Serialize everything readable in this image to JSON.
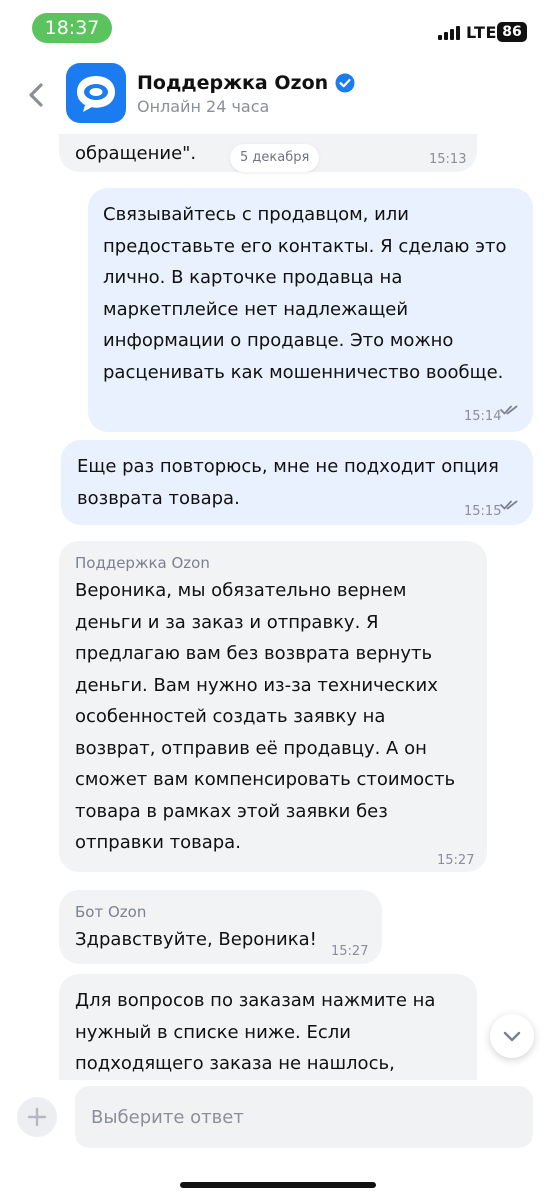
{
  "status_bar": {
    "time": "18:37",
    "network": "LTE",
    "battery": "86"
  },
  "header": {
    "title": "Поддержка Ozon",
    "subtitle": "Онлайн 24 часа",
    "icons": {
      "back": "chevron-left-icon",
      "verified": "verified-check-icon",
      "avatar": "chat-bubble-logo"
    },
    "colors": {
      "accent": "#1a7cf0",
      "verified": "#1a7cf0"
    }
  },
  "date_separator": "5 декабря",
  "messages": [
    {
      "direction": "in",
      "lines": [
        "обращение\"."
      ],
      "time": "15:13"
    },
    {
      "direction": "out",
      "lines": [
        "Связывайтесь с продавцом, или",
        "предоставьте его контакты. Я сделаю это",
        "лично. В карточке продавца на",
        "маркетплейсе нет надлежащей",
        "информации о продавце. Это можно",
        "расценивать как мошенничество вообще."
      ],
      "time": "15:14",
      "read": true
    },
    {
      "direction": "out",
      "lines": [
        "Еще раз повторюсь, мне не подходит опция",
        "возврата товара."
      ],
      "time": "15:15",
      "read": true
    },
    {
      "direction": "in",
      "sender": "Поддержка Ozon",
      "lines": [
        "Вероника, мы обязательно вернем",
        "деньги и за заказ и отправку. Я",
        "предлагаю вам без возврата вернуть",
        "деньги. Вам нужно из-за технических",
        "особенностей создать заявку на",
        "возврат, отправив её продавцу. А он",
        "сможет вам компенсировать стоимость",
        "товара в рамках этой заявки без",
        "отправки товара."
      ],
      "time": "15:27"
    },
    {
      "direction": "in",
      "sender": "Бот Ozon",
      "lines": [
        "Здравствуйте, Вероника!"
      ],
      "time": "15:27"
    },
    {
      "direction": "in",
      "lines": [
        "Для вопросов по заказам нажмите на",
        "нужный в списке ниже. Если",
        "подходящего заказа не нашлось,"
      ],
      "time": ""
    }
  ],
  "input": {
    "placeholder": "Выберите ответ",
    "value": ""
  },
  "colors": {
    "incoming_bubble": "#f2f3f5",
    "outgoing_bubble": "#e8f1fd",
    "status_pill": "#5bc45f"
  }
}
